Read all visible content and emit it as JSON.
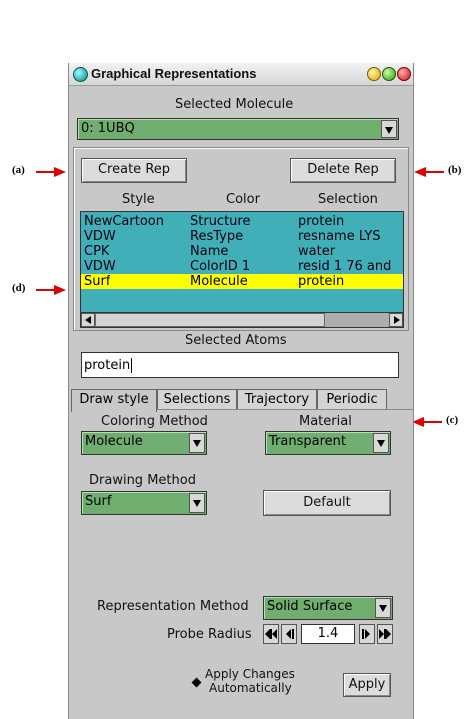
{
  "annotations": {
    "a": "(a)",
    "b": "(b)",
    "c": "(c)",
    "d": "(d)"
  },
  "window": {
    "title": "Graphical Representations"
  },
  "molecule": {
    "label": "Selected Molecule",
    "value": "0: 1UBQ"
  },
  "buttons": {
    "create": "Create Rep",
    "delete": "Delete Rep",
    "default": "Default",
    "apply": "Apply"
  },
  "columns": [
    "Style",
    "Color",
    "Selection"
  ],
  "reps": [
    {
      "style": "NewCartoon",
      "color": "Structure",
      "selection": "protein"
    },
    {
      "style": "VDW",
      "color": "ResType",
      "selection": "resname LYS"
    },
    {
      "style": "CPK",
      "color": "Name",
      "selection": "water"
    },
    {
      "style": "VDW",
      "color": "ColorID 1",
      "selection": "resid 1 76 and"
    },
    {
      "style": "Surf",
      "color": "Molecule",
      "selection": "protein"
    }
  ],
  "selected_rep_index": 4,
  "atoms": {
    "label": "Selected Atoms",
    "value": "protein"
  },
  "tabs": [
    "Draw style",
    "Selections",
    "Trajectory",
    "Periodic"
  ],
  "active_tab": 0,
  "coloring": {
    "label": "Coloring Method",
    "value": "Molecule"
  },
  "material": {
    "label": "Material",
    "value": "Transparent"
  },
  "drawing": {
    "label": "Drawing Method",
    "value": "Surf"
  },
  "rep_method": {
    "label": "Representation Method",
    "value": "Solid Surface"
  },
  "probe": {
    "label": "Probe Radius",
    "value": "1.4"
  },
  "apply_auto": {
    "line1": "Apply Changes",
    "line2": "Automatically"
  },
  "colors": {
    "panel": "#c8c8c8",
    "list": "#41afb8",
    "selected_row": "#ffff00",
    "dropdown": "#6fae6f",
    "annotation_arrow": "#e00000"
  }
}
